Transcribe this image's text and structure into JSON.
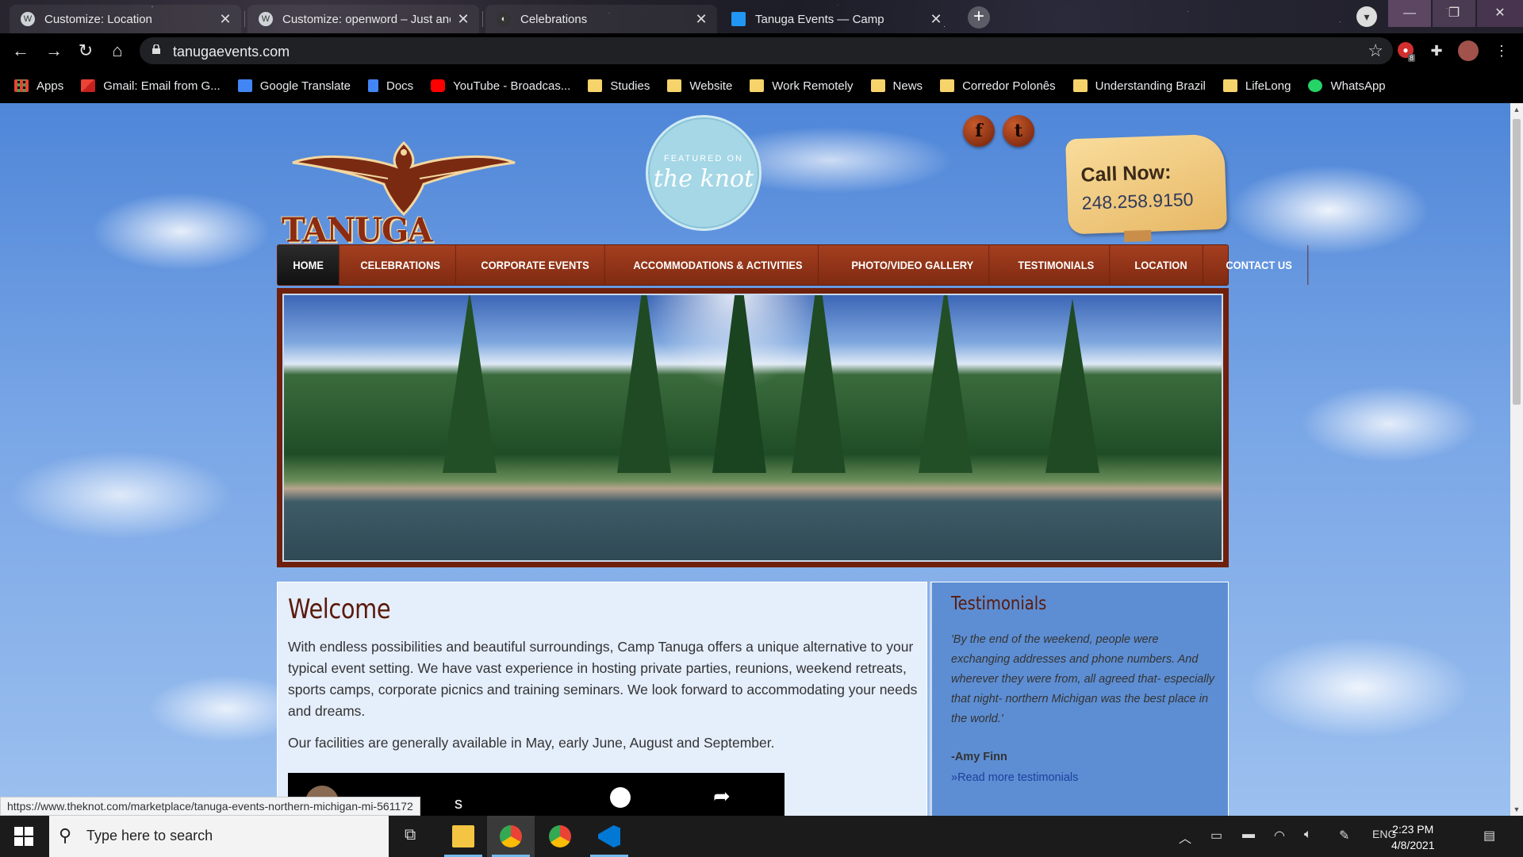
{
  "browser": {
    "tabs": [
      {
        "title": "Customize: Location",
        "active": false
      },
      {
        "title": "Customize: openword – Just anc",
        "active": false
      },
      {
        "title": "Celebrations",
        "active": false
      },
      {
        "title": "Tanuga Events — Camp",
        "active": true
      }
    ],
    "url": "tanugaevents.com",
    "bookmarks": [
      {
        "label": "Apps",
        "icon": "apps-grid-icon"
      },
      {
        "label": "Gmail: Email from G...",
        "icon": "gmail-icon"
      },
      {
        "label": "Google Translate",
        "icon": "translate-icon"
      },
      {
        "label": "Docs",
        "icon": "docs-icon"
      },
      {
        "label": "YouTube - Broadcas...",
        "icon": "youtube-icon"
      },
      {
        "label": "Studies",
        "icon": "folder-icon"
      },
      {
        "label": "Website",
        "icon": "folder-icon"
      },
      {
        "label": "Work Remotely",
        "icon": "folder-icon"
      },
      {
        "label": "News",
        "icon": "folder-icon"
      },
      {
        "label": "Corredor Polonês",
        "icon": "folder-icon"
      },
      {
        "label": "Understanding Brazil",
        "icon": "folder-icon"
      },
      {
        "label": "LifeLong",
        "icon": "folder-icon"
      },
      {
        "label": "WhatsApp",
        "icon": "whatsapp-icon"
      }
    ],
    "extension_badge": "8",
    "status_url": "https://www.theknot.com/marketplace/tanuga-events-northern-michigan-mi-561172"
  },
  "site": {
    "logo_text": "TANUGA EVENTS",
    "knot_badge": {
      "small": "FEATURED ON",
      "big": "the knot"
    },
    "social": {
      "facebook": "f",
      "twitter": "t"
    },
    "call": {
      "label": "Call Now:",
      "phone": "248.258.9150"
    },
    "nav": [
      "HOME",
      "CELEBRATIONS",
      "CORPORATE EVENTS",
      "ACCOMMODATIONS & ACTIVITIES",
      "PHOTO/VIDEO GALLERY",
      "TESTIMONIALS",
      "LOCATION",
      "CONTACT US"
    ],
    "welcome": {
      "title": "Welcome",
      "p1": "With endless possibilities and beautiful surroundings, Camp Tanuga offers a unique alternative to your typical event setting. We have vast experience in hosting private parties, reunions, weekend retreats, sports camps, corporate picnics and training seminars. We look forward to accommodating your needs and dreams.",
      "p2": "Our facilities are generally available in May, early June, August and September.",
      "video_title_fragment": "s"
    },
    "testimonials": {
      "title": "Testimonials",
      "quote": "'By the end of the weekend, people were exchanging addresses and phone numbers. And wherever they were from, all agreed that- especially that night- northern Michigan was the best place in the world.'",
      "author": "-Amy Finn",
      "more": "»Read more testimonials"
    }
  },
  "taskbar": {
    "search_placeholder": "Type here to search",
    "language": "ENG",
    "time": "2:23 PM",
    "date": "4/8/2021"
  },
  "colors": {
    "nav_bg": "#8f3418",
    "accent_brown": "#5a1a0c",
    "sky": "#79a6e6",
    "sidebar_bg": "#5d8ed3"
  }
}
